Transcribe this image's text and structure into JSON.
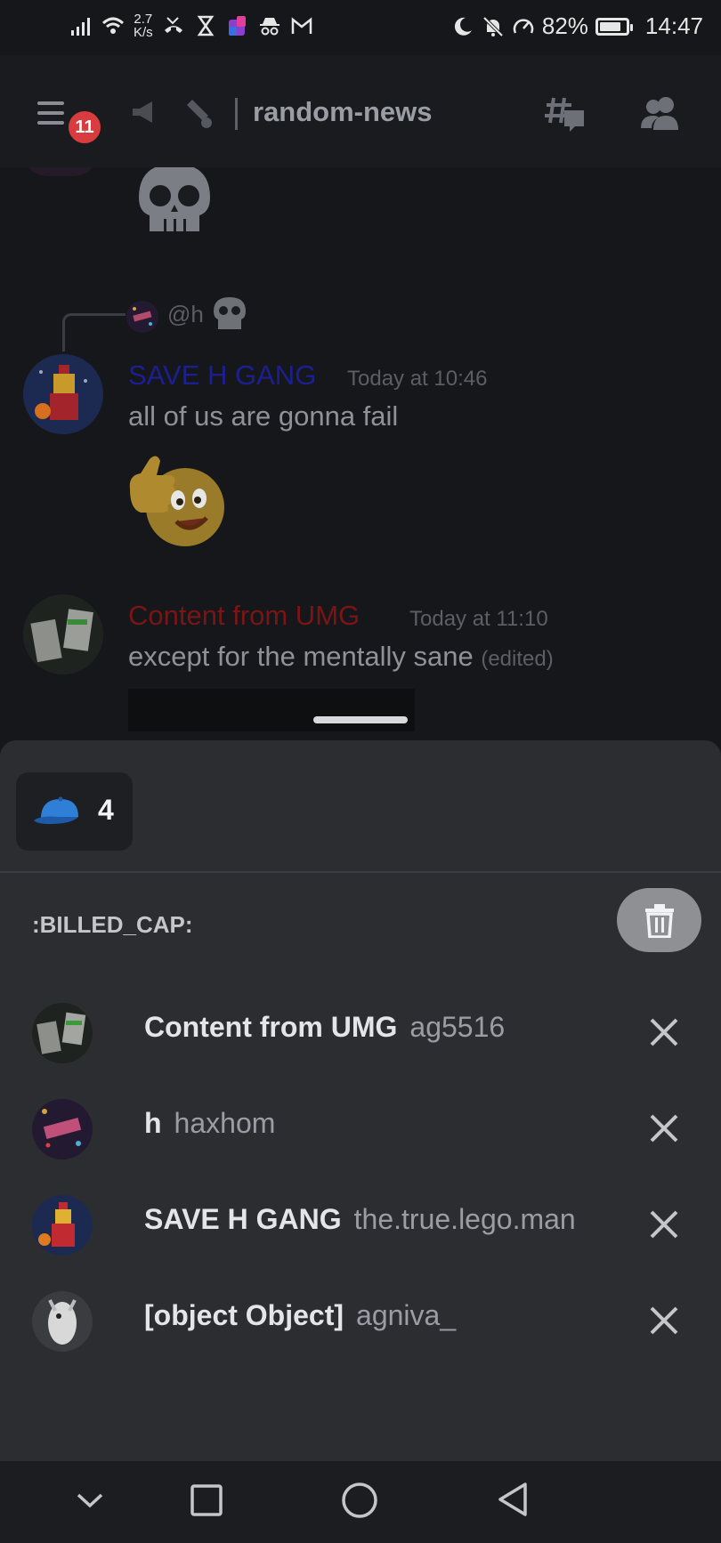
{
  "status_bar": {
    "net_speed_value": "2.7",
    "net_speed_unit": "K/s",
    "battery": "82%",
    "time": "14:47",
    "battery_level": 0.82
  },
  "header": {
    "notification_count": "11",
    "channel_name": "random-news"
  },
  "chat": {
    "reply_mention": "@h",
    "messages": [
      {
        "author": "SAVE H GANG",
        "author_color": "#1c1f8f",
        "timestamp": "Today at 10:46",
        "text": "all of us are gonna fail"
      },
      {
        "author": "Content from UMG",
        "author_color": "#7a1515",
        "timestamp": "Today at 11:10",
        "text": "except for the mentally sane",
        "edited": "(edited)"
      }
    ]
  },
  "reactions_sheet": {
    "reaction_count": "4",
    "reaction_emoji_icon": "billed-cap-icon",
    "emoji_name": ":BILLED_CAP:",
    "users": [
      {
        "display_name": "Content from UMG",
        "username": "ag5516"
      },
      {
        "display_name": "h",
        "username": "haxhom"
      },
      {
        "display_name": "SAVE H GANG",
        "username": "the.true.lego.man"
      },
      {
        "display_name": "[object Object]",
        "username": "agniva_"
      }
    ]
  },
  "nav_bar": {
    "icons": [
      "chevron-down-icon",
      "recents-square-icon",
      "home-circle-icon",
      "back-triangle-icon"
    ]
  }
}
